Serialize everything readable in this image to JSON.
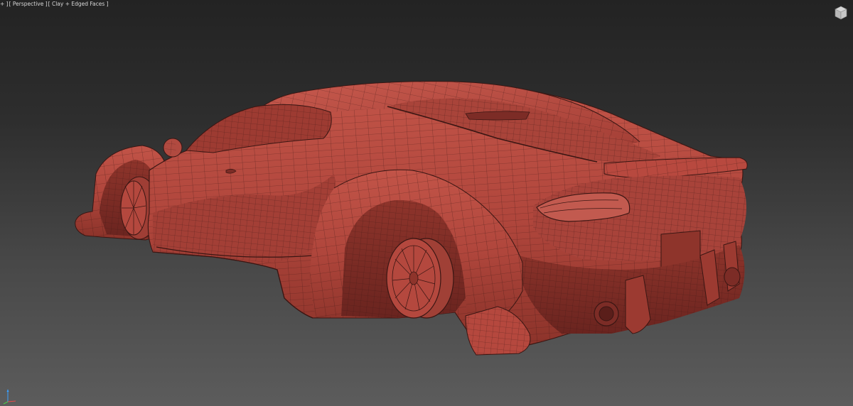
{
  "viewport": {
    "menu_plus": "+ ]",
    "view_menu": "[ Perspective ]",
    "shading_menu": "[ Clay + Edged Faces ]"
  },
  "colors": {
    "clay": "#b4483e",
    "clay_dark": "#7c2c26",
    "clay_light": "#c9594d",
    "wire": "#3a1613",
    "background_top": "#232323",
    "background_bottom": "#5c5c5c"
  },
  "icons": {
    "viewcube": "viewcube-icon",
    "axis_gizmo": "axis-tripod-icon"
  }
}
